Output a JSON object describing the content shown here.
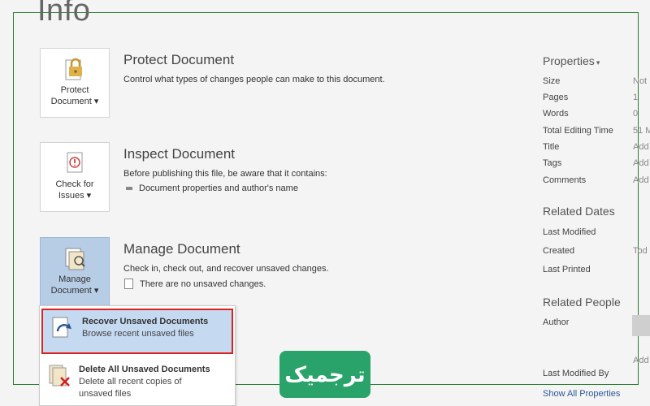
{
  "page": {
    "title": "Info"
  },
  "protect": {
    "button_label_1": "Protect",
    "button_label_2": "Document ▾",
    "heading": "Protect Document",
    "description": "Control what types of changes people can make to this document."
  },
  "inspect": {
    "button_label_1": "Check for",
    "button_label_2": "Issues ▾",
    "heading": "Inspect Document",
    "description": "Before publishing this file, be aware that it contains:",
    "bullet": "Document properties and author's name"
  },
  "manage": {
    "button_label_1": "Manage",
    "button_label_2": "Document ▾",
    "heading": "Manage Document",
    "description": "Check in, check out, and recover unsaved changes.",
    "status": "There are no unsaved changes."
  },
  "dropdown": {
    "items": [
      {
        "title": "Recover Unsaved Documents",
        "subtitle": "Browse recent unsaved files"
      },
      {
        "title": "Delete All Unsaved Documents",
        "subtitle": "Delete all recent copies of",
        "subtitle2": "unsaved files"
      }
    ]
  },
  "properties": {
    "header": "Properties",
    "rows": [
      {
        "key": "Size",
        "value": "Not"
      },
      {
        "key": "Pages",
        "value": "1"
      },
      {
        "key": "Words",
        "value": "0"
      },
      {
        "key": "Total Editing Time",
        "value": "51 M"
      },
      {
        "key": "Title",
        "value": "Add"
      },
      {
        "key": "Tags",
        "value": "Add"
      },
      {
        "key": "Comments",
        "value": "Add"
      }
    ]
  },
  "related_dates": {
    "header": "Related Dates",
    "rows": [
      {
        "key": "Last Modified",
        "value": ""
      },
      {
        "key": "Created",
        "value": "Tod"
      },
      {
        "key": "Last Printed",
        "value": ""
      }
    ]
  },
  "related_people": {
    "header": "Related People",
    "author_label": "Author",
    "add_author": "Add",
    "last_modified_by": "Last Modified By",
    "show_all": "Show All Properties"
  },
  "watermark": {
    "text": "ترجمیک"
  },
  "colors": {
    "accent_blue": "#b7cde6",
    "highlight": "#c5d9f1",
    "red_border": "#e02020",
    "badge_green": "#2aa36a",
    "frame_green": "#2e7d32"
  }
}
